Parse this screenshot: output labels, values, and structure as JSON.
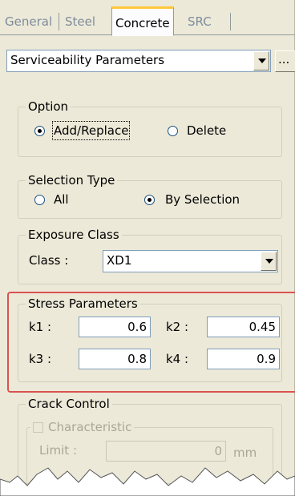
{
  "tabs": [
    {
      "label": "General",
      "active": false
    },
    {
      "label": "Steel",
      "active": false
    },
    {
      "label": "Concrete",
      "active": true
    },
    {
      "label": "SRC",
      "active": false
    }
  ],
  "parameter_dropdown": {
    "value": "Serviceability Parameters"
  },
  "ellipsis_label": "...",
  "option": {
    "legend": "Option",
    "add_replace": "Add/Replace",
    "delete": "Delete",
    "selected": "Add/Replace"
  },
  "selection_type": {
    "legend": "Selection Type",
    "all": "All",
    "by_selection": "By Selection",
    "selected": "By Selection"
  },
  "exposure_class": {
    "legend": "Exposure Class",
    "class_label": "Class :",
    "class_value": "XD1"
  },
  "stress_parameters": {
    "legend": "Stress Parameters",
    "k1_label": "k1 :",
    "k1": "0.6",
    "k2_label": "k2 :",
    "k2": "0.45",
    "k3_label": "k3 :",
    "k3": "0.8",
    "k4_label": "k4 :",
    "k4": "0.9"
  },
  "crack_control": {
    "legend": "Crack Control",
    "characteristic_label": "Characteristic",
    "limit_label": "Limit :",
    "limit_value": "0",
    "unit": "mm"
  },
  "colors": {
    "highlight": "#d9534f",
    "active_tab_accent": "#ffc83c",
    "panel_bg": "#ece9d8"
  }
}
